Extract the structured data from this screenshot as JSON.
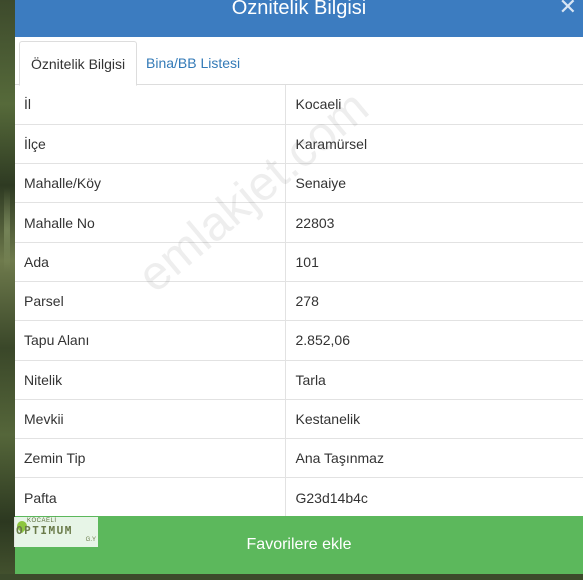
{
  "header": {
    "title": "Öznitelik Bilgisi",
    "close_glyph": "✕"
  },
  "tabs": [
    {
      "label": "Öznitelik Bilgisi",
      "active": true
    },
    {
      "label": "Bina/BB Listesi",
      "active": false
    }
  ],
  "attributes": [
    {
      "key": "İl",
      "value": "Kocaeli"
    },
    {
      "key": "İlçe",
      "value": "Karamürsel"
    },
    {
      "key": "Mahalle/Köy",
      "value": "Senaiye"
    },
    {
      "key": "Mahalle No",
      "value": "22803"
    },
    {
      "key": "Ada",
      "value": "101"
    },
    {
      "key": "Parsel",
      "value": "278"
    },
    {
      "key": "Tapu Alanı",
      "value": "2.852,06"
    },
    {
      "key": "Nitelik",
      "value": "Tarla"
    },
    {
      "key": "Mevkii",
      "value": "Kestanelik"
    },
    {
      "key": "Zemin Tip",
      "value": "Ana Taşınmaz"
    },
    {
      "key": "Pafta",
      "value": "G23d14b4c"
    }
  ],
  "favorite_button": {
    "label": "Favorilere ekle"
  },
  "watermark": {
    "text": "emlakjet.com"
  },
  "logo": {
    "top_text": "KOCAELİ",
    "main_text": "OPTIMUM",
    "sub_text": "G.Y"
  },
  "icons": {
    "menu": "vertical-dots-icon",
    "close": "close-icon"
  },
  "colors": {
    "header": "#3c7cc0",
    "button": "#5cb85c",
    "tab_link": "#337ab7"
  }
}
